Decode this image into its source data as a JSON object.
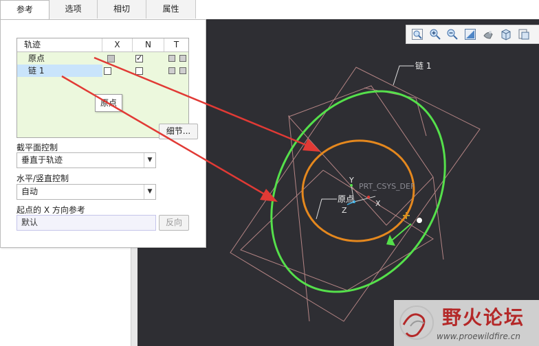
{
  "tabs": [
    {
      "label": "参考"
    },
    {
      "label": "选项"
    },
    {
      "label": "相切"
    },
    {
      "label": "属性"
    }
  ],
  "trajectory_table": {
    "headers": {
      "name": "轨迹",
      "x": "X",
      "n": "N",
      "t": "T"
    },
    "rows": [
      {
        "name": "原点",
        "x": "grey",
        "n": "checked",
        "selected": false
      },
      {
        "name": "链 1",
        "x": "unchecked",
        "n": "unchecked",
        "selected": true
      }
    ]
  },
  "tooltip": "原点",
  "details_button": "细节...",
  "section_plane": {
    "label": "截平面控制",
    "value": "垂直于轨迹"
  },
  "horizontal_vertical": {
    "label": "水平/竖直控制",
    "value": "自动"
  },
  "start_x_ref": {
    "label": "起点的 X 方向参考",
    "value": "默认",
    "button": "反向"
  },
  "viewport": {
    "labels": {
      "chain": "链 1",
      "origin": "原点",
      "csys": "PRT_CSYS_DEF",
      "axis_x": "X",
      "axis_y": "Y",
      "axis_z": "Z"
    },
    "colors": {
      "background": "#2e2e33",
      "chain": "#55e04b",
      "origin_curve": "#e5881e",
      "datum_planes": "#b58585",
      "arrow": "#e13a35"
    }
  },
  "toolbar_icons": [
    "zoom-window-icon",
    "zoom-in-icon",
    "zoom-out-icon",
    "refit-icon",
    "display-style-icon",
    "saved-views-icon",
    "view-manager-icon"
  ],
  "watermark": {
    "title": "野火论坛",
    "url": "www.proewildfire.cn"
  }
}
